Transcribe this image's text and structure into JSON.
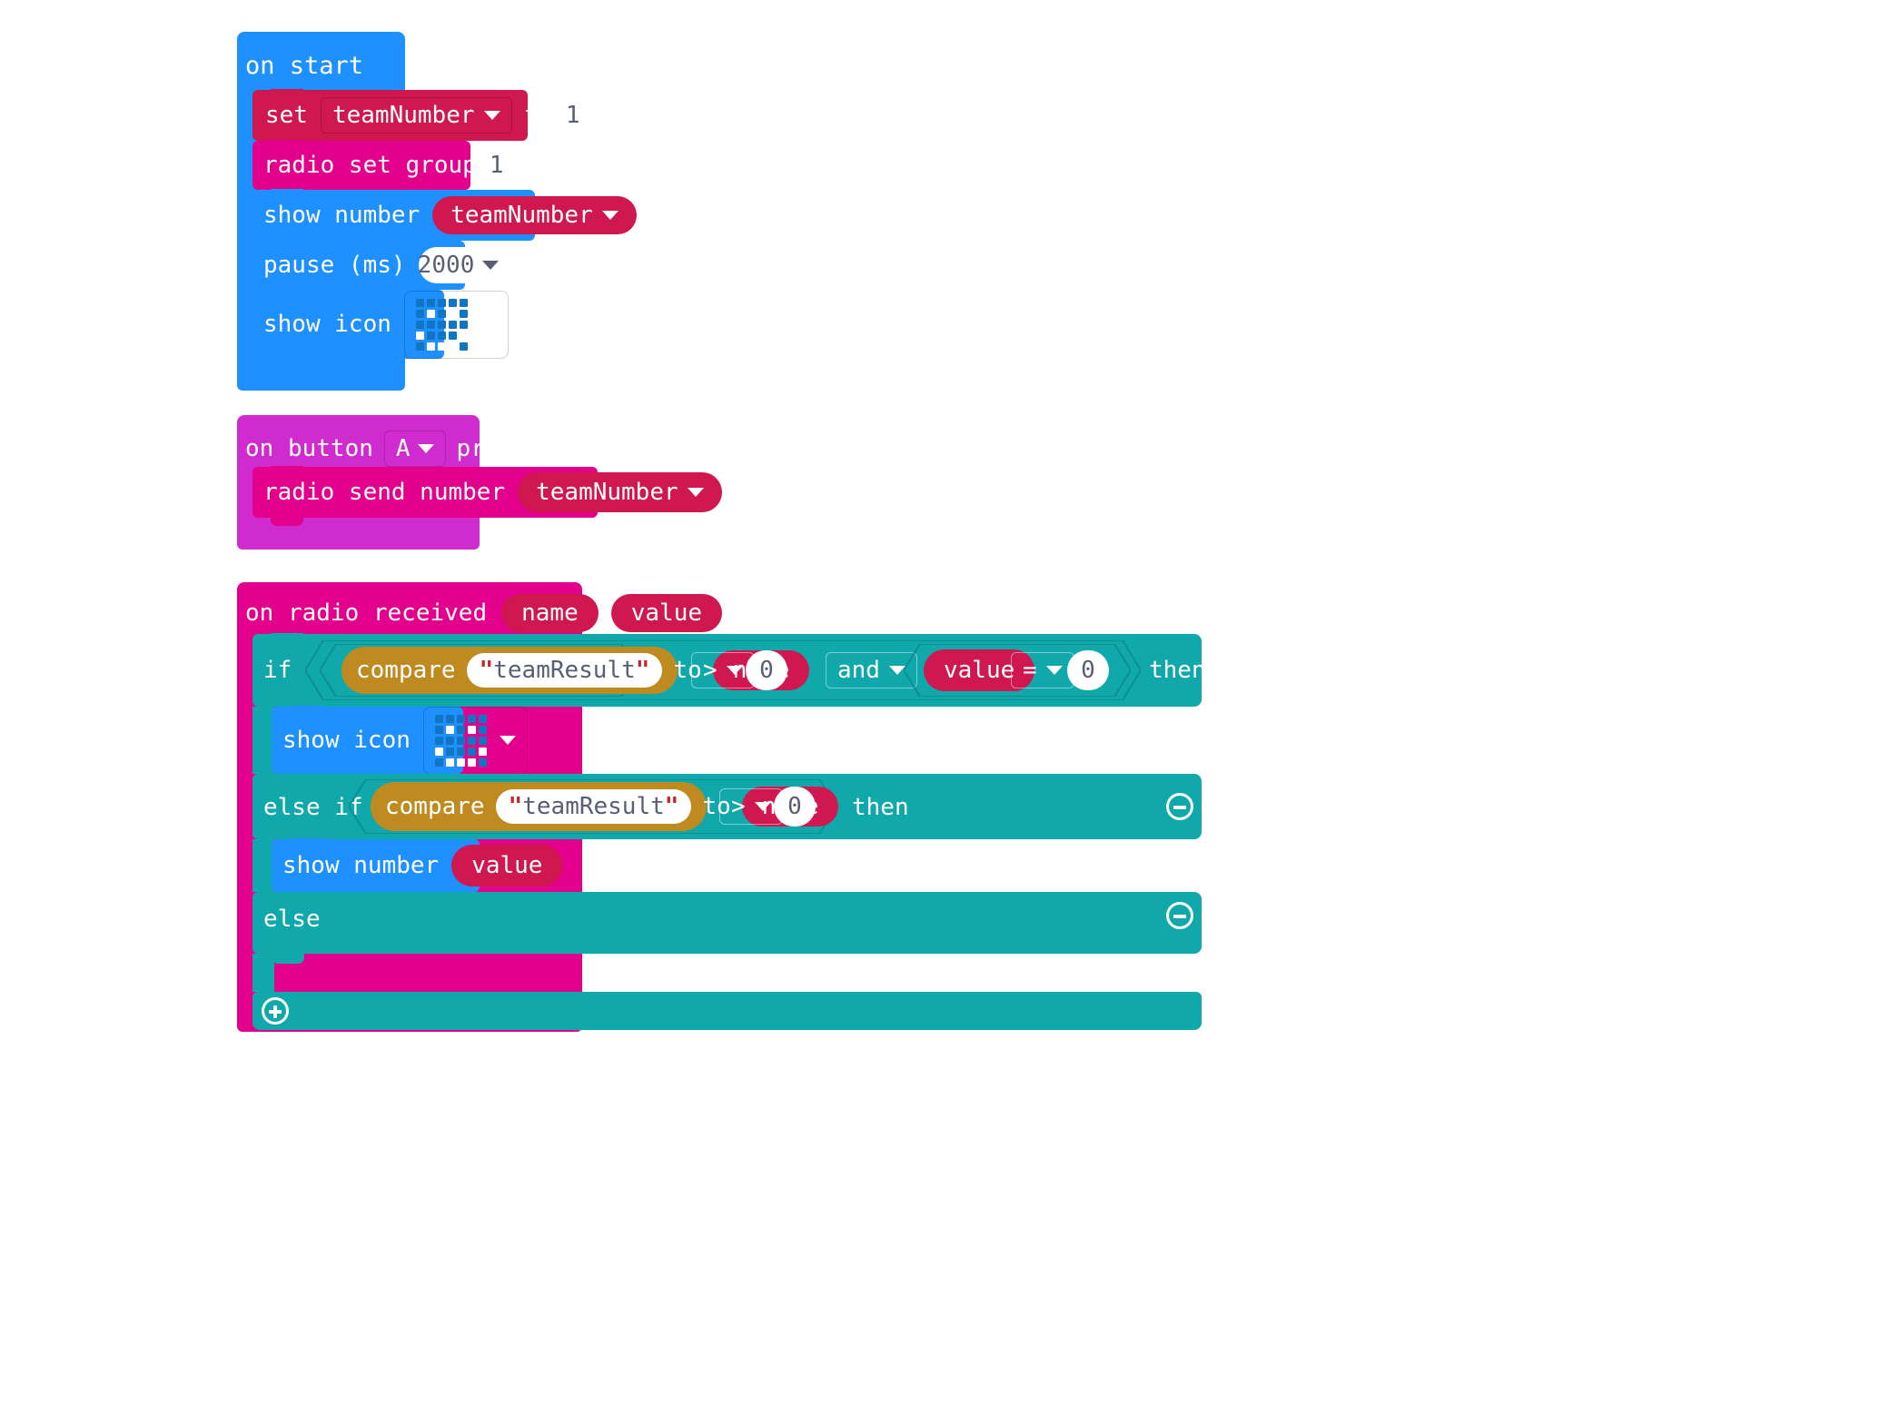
{
  "editor": {
    "name": "makecode-blocks-workspace",
    "background": "#ffffff"
  },
  "colors": {
    "basic_blue": "#1e90ff",
    "variables_red": "#cf1750",
    "radio_pink": "#e3008c",
    "input_magenta": "#d02bce",
    "logic_teal": "#11a8ab",
    "text_gold": "#bf8b20",
    "field_white": "#ffffff",
    "field_text": "#575e75",
    "led_off": "#1076c4",
    "led_on": "#ffffff"
  },
  "scripts": [
    {
      "id": "on-start",
      "hat_label": "on start",
      "statements": [
        {
          "id": "set-variable",
          "parts": [
            "set",
            "to"
          ],
          "variable": "teamNumber",
          "value": "1"
        },
        {
          "id": "radio-set-group",
          "label": "radio set group",
          "value": "1"
        },
        {
          "id": "show-number",
          "label": "show number",
          "variable": "teamNumber"
        },
        {
          "id": "pause",
          "label": "pause (ms)",
          "value": "2000"
        },
        {
          "id": "show-icon",
          "label": "show icon",
          "icon_name": "led-happy-face",
          "icon_pattern": [
            [
              0,
              0,
              0,
              0,
              0
            ],
            [
              0,
              1,
              0,
              1,
              0
            ],
            [
              0,
              0,
              0,
              0,
              0
            ],
            [
              1,
              0,
              0,
              0,
              1
            ],
            [
              0,
              1,
              1,
              1,
              0
            ]
          ]
        }
      ]
    },
    {
      "id": "on-button-pressed",
      "hat_label_before": "on button",
      "hat_dropdown": "A",
      "hat_label_after": "pressed",
      "statements": [
        {
          "id": "radio-send-number",
          "label": "radio send number",
          "variable": "teamNumber"
        }
      ]
    },
    {
      "id": "on-radio-received",
      "hat_label": "on radio received",
      "hat_params": [
        "name",
        "value"
      ],
      "logic": {
        "if_label": "if",
        "then_label": "then",
        "else_if_label": "else if",
        "else_label": "else",
        "if_condition": {
          "compare": {
            "label": "compare",
            "string_value": "teamResult",
            "to_label": "to",
            "variable": "name"
          },
          "operator": ">",
          "operand": "0",
          "join_operator": "and",
          "second": {
            "variable": "value",
            "operator": "=",
            "operand": "0"
          }
        },
        "if_body": [
          {
            "id": "show-icon-2",
            "label": "show icon",
            "icon_name": "led-happy-face",
            "icon_pattern": [
              [
                0,
                0,
                0,
                0,
                0
              ],
              [
                0,
                1,
                0,
                1,
                0
              ],
              [
                0,
                0,
                0,
                0,
                0
              ],
              [
                1,
                0,
                0,
                0,
                1
              ],
              [
                0,
                1,
                1,
                1,
                0
              ]
            ]
          }
        ],
        "else_if_condition": {
          "compare": {
            "label": "compare",
            "string_value": "teamResult",
            "to_label": "to",
            "variable": "name"
          },
          "operator": ">",
          "operand": "0"
        },
        "else_if_body": [
          {
            "id": "show-number-value",
            "label": "show number",
            "variable": "value"
          }
        ],
        "else_body": [],
        "collapse_icons": [
          "minus",
          "minus"
        ],
        "expand_icon": "plus"
      }
    }
  ]
}
